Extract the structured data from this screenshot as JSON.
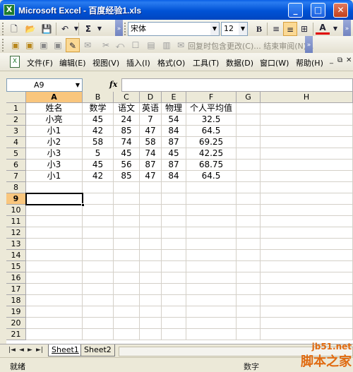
{
  "window": {
    "title": "Microsoft Excel - 百度经验1.xls",
    "app_icon": "X"
  },
  "toolbar_standard": {
    "font_name": "宋体",
    "font_size": "12",
    "bold_label": "B",
    "font_color_label": "A"
  },
  "toolbar_review": {
    "review_text": "回复时包含更改(C)...  结束审阅(N)..."
  },
  "menu": {
    "items": [
      "文件(F)",
      "编辑(E)",
      "视图(V)",
      "插入(I)",
      "格式(O)",
      "工具(T)",
      "数据(D)",
      "窗口(W)",
      "帮助(H)"
    ]
  },
  "formula_bar": {
    "name_box": "A9",
    "fx_label": "fx",
    "content": ""
  },
  "sheet": {
    "columns": [
      "A",
      "B",
      "C",
      "D",
      "E",
      "F",
      "G",
      "H"
    ],
    "rows": [
      "1",
      "2",
      "3",
      "4",
      "5",
      "6",
      "7",
      "8",
      "9",
      "10",
      "11",
      "12",
      "13",
      "14",
      "15",
      "16",
      "17",
      "18",
      "19",
      "20",
      "21"
    ],
    "data": [
      [
        "姓名",
        "数学",
        "语文",
        "英语",
        "物理",
        "个人平均值"
      ],
      [
        "小亮",
        "45",
        "24",
        "7",
        "54",
        "32.5"
      ],
      [
        "小1",
        "42",
        "85",
        "47",
        "84",
        "64.5"
      ],
      [
        "小2",
        "58",
        "74",
        "58",
        "87",
        "69.25"
      ],
      [
        "小3",
        "5",
        "45",
        "74",
        "45",
        "42.25"
      ],
      [
        "小3",
        "45",
        "56",
        "87",
        "87",
        "68.75"
      ],
      [
        "小1",
        "42",
        "85",
        "47",
        "84",
        "64.5"
      ]
    ],
    "active_cell": "A9"
  },
  "tabs": {
    "items": [
      "Sheet1",
      "Sheet2"
    ],
    "active": "Sheet1",
    "nav": [
      "|◄",
      "◄",
      "►",
      "►|"
    ]
  },
  "status": {
    "text": "就绪",
    "mode": "数字"
  },
  "watermark": {
    "line1": "jb51.net",
    "line2": "脚本之家"
  }
}
